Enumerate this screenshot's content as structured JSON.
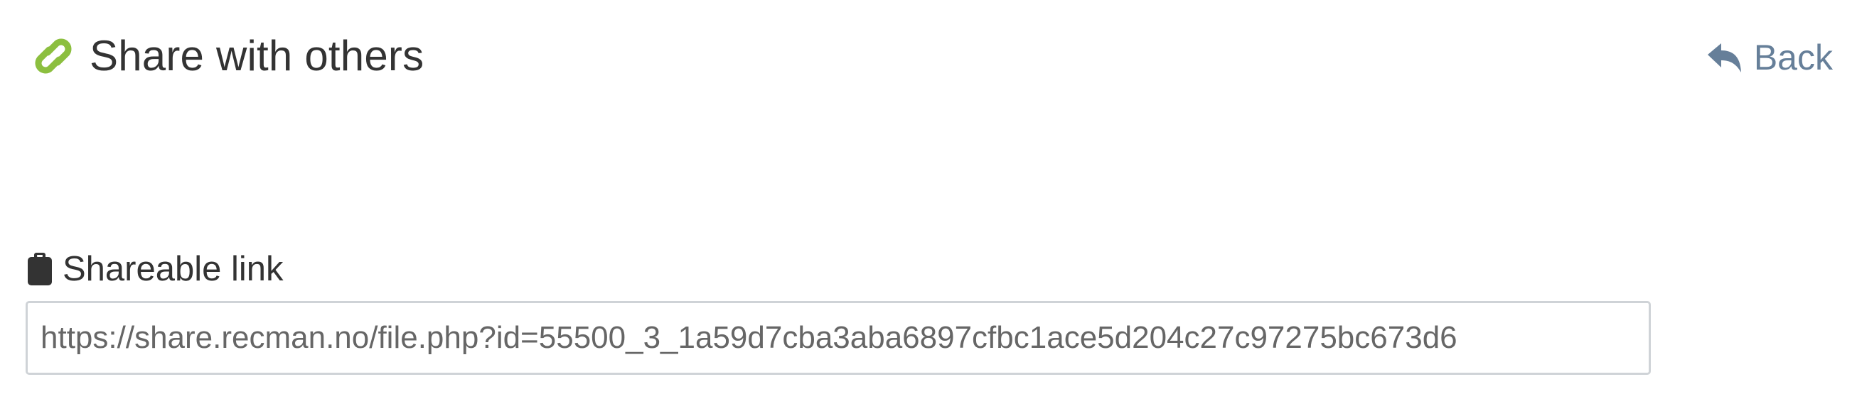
{
  "header": {
    "title": "Share with others",
    "icon": "link-icon",
    "icon_color": "#8cbf3f"
  },
  "back": {
    "label": "Back",
    "icon": "reply-arrow-icon",
    "color": "#667f99"
  },
  "shareable_link": {
    "label": "Shareable link",
    "icon": "clipboard-icon",
    "value": "https://share.recman.no/file.php?id=55500_3_1a59d7cba3aba6897cfbc1ace5d204c27c97275bc673d6"
  }
}
